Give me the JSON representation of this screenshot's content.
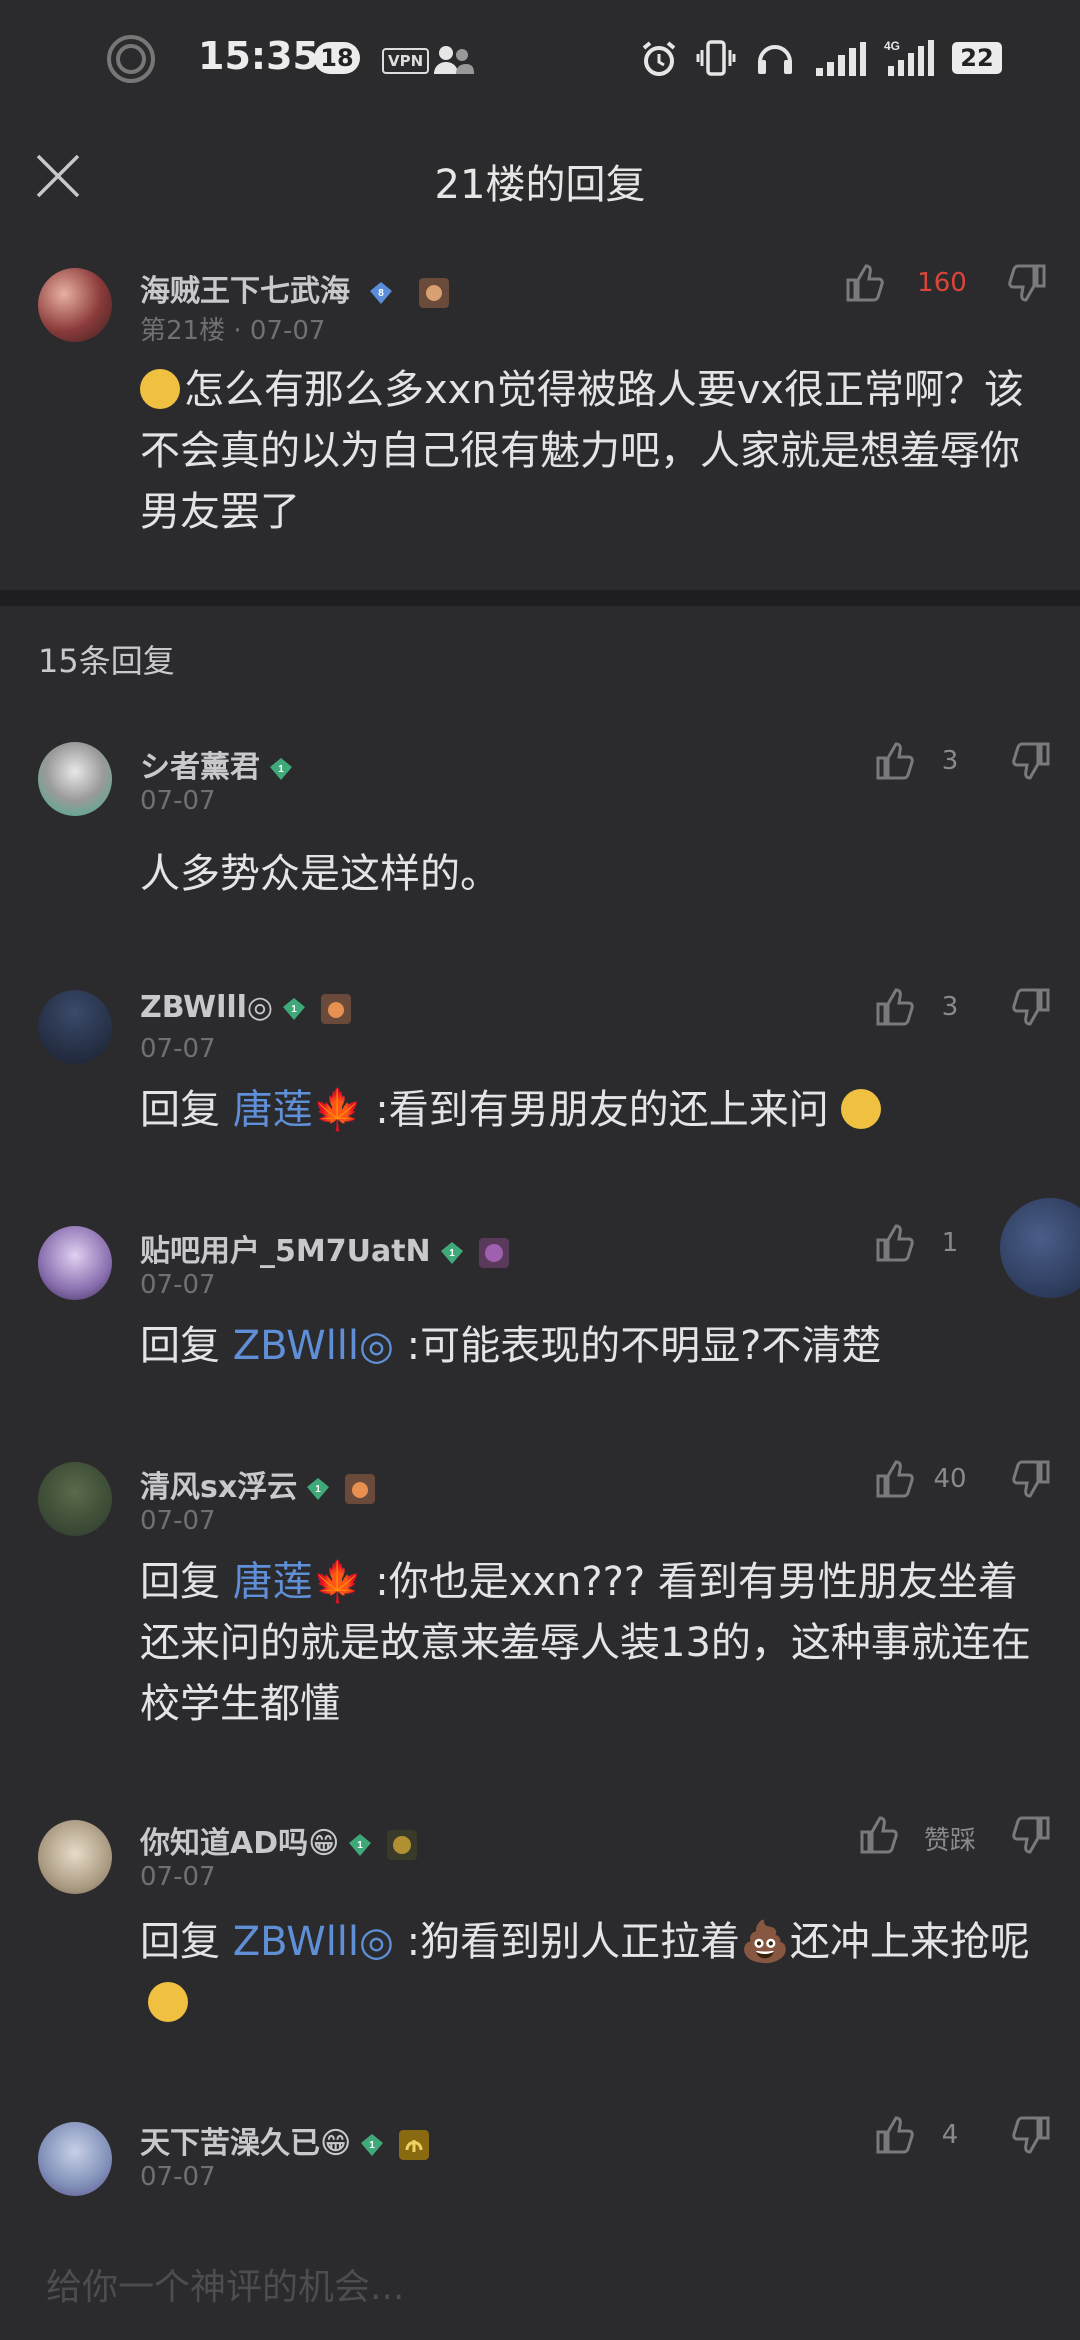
{
  "status_bar": {
    "time": "15:35",
    "notif_count": "18",
    "vpn": "VPN",
    "battery": "22",
    "network": "4G"
  },
  "header": {
    "title": "21楼的回复"
  },
  "main_post": {
    "username": "海贼王下七武海",
    "level": "8",
    "meta": "第21楼 · 07-07",
    "likes": "160",
    "text": "怎么有那么多xxn觉得被路人要vx很正常啊？该不会真的以为自己很有魅力吧，人家就是想羞辱你男友罢了"
  },
  "section": {
    "replies_count_label": "15条回复"
  },
  "replies": [
    {
      "username": "シ者薰君",
      "level": "1",
      "date": "07-07",
      "likes": "3",
      "prefix": "",
      "reply_to": "",
      "text": "人多势众是这样的。"
    },
    {
      "username": "ZBWlll◎",
      "level": "1",
      "date": "07-07",
      "likes": "3",
      "prefix": "回复",
      "reply_to": "唐莲🍁",
      "text": ":看到有男朋友的还上来问"
    },
    {
      "username": "贴吧用户_5M7UatN",
      "level": "1",
      "date": "07-07",
      "likes": "1",
      "prefix": "回复",
      "reply_to": "ZBWlll◎",
      "text": ":可能表现的不明显?不清楚"
    },
    {
      "username": "清风sx浮云",
      "level": "1",
      "date": "07-07",
      "likes": "40",
      "prefix": "回复",
      "reply_to": "唐莲🍁",
      "text": ":你也是xxn???  看到有男性朋友坐着还来问的就是故意来羞辱人装13的，这种事就连在校学生都懂"
    },
    {
      "username": "你知道AD吗😁",
      "level": "1",
      "date": "07-07",
      "likes": "赞踩",
      "prefix": "回复",
      "reply_to": "ZBWlll◎",
      "text": ":狗看到别人正拉着💩还冲上来抢呢"
    },
    {
      "username": "天下苦澡久已😁",
      "level": "1",
      "date": "07-07",
      "likes": "4",
      "prefix": "",
      "reply_to": "",
      "text": ""
    }
  ],
  "input": {
    "placeholder": "给你一个神评的机会..."
  },
  "colors": {
    "background": "#2b2b2d",
    "link": "#5f8fd6",
    "like_active": "#d9453b",
    "gem_green": "#3fa97a",
    "gem_blue": "#5a8ed8"
  }
}
